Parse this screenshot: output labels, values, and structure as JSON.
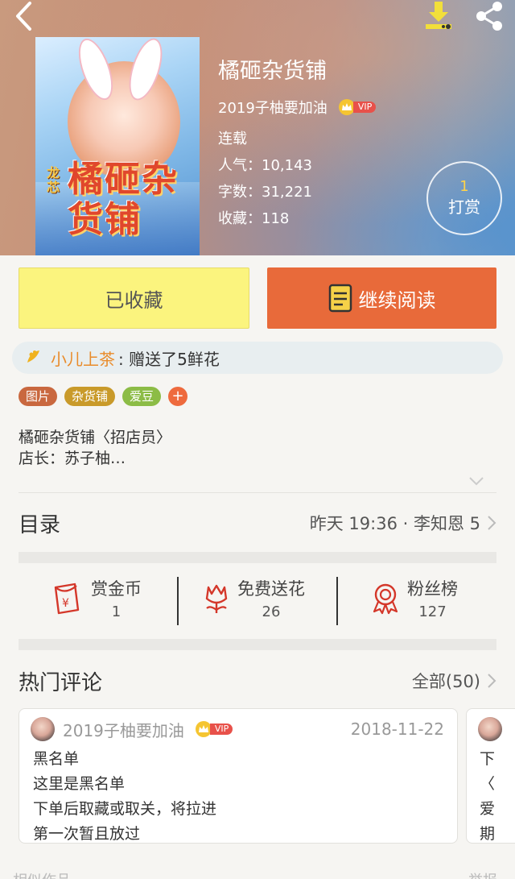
{
  "book": {
    "title": "橘砸杂货铺",
    "author": "2019子柚要加油",
    "vip_label": "VIP",
    "status": "连载",
    "popularity": "人气：10,143",
    "word_count": "字数：31,221",
    "favorites": "收藏：118",
    "cover_title": "橘砸杂货铺",
    "cover_tag": "龙芯"
  },
  "reward": {
    "count": "1",
    "label": "打赏"
  },
  "actions": {
    "collect_label": "已收藏",
    "read_label": "继续阅读"
  },
  "gift": {
    "giver": "小儿上茶",
    "message": ": 赠送了5鲜花"
  },
  "tags": [
    "图片",
    "杂货铺",
    "爱豆"
  ],
  "tag_add": "+",
  "description": {
    "line1": "橘砸杂货铺〈招店员〉",
    "line2": "店长：苏子柚…"
  },
  "catalog": {
    "title": "目录",
    "latest": "昨天 19:36 · 李知恩 5"
  },
  "stats": [
    {
      "name": "赏金币",
      "value": "1"
    },
    {
      "name": "免费送花",
      "value": "26"
    },
    {
      "name": "粉丝榜",
      "value": "127"
    }
  ],
  "hot_comments": {
    "title": "热门评论",
    "all_label": "全部(50)"
  },
  "comments": [
    {
      "user": "2019子柚要加油",
      "vip_label": "VIP",
      "date": "2018-11-22",
      "lines": [
        "黑名单",
        "这里是黑名单",
        "下单后取藏或取关，将拉进",
        "第一次暂且放过"
      ]
    },
    {
      "lines": [
        "下",
        "〈",
        "爱",
        "期"
      ]
    }
  ],
  "footer": {
    "left": "相似作品",
    "right": "举报"
  },
  "colors": {
    "accent_orange": "#e86a3a",
    "collect_yellow": "#fbf47e",
    "tag_red": "#c9683f",
    "tag_gold": "#c99a2a",
    "tag_green": "#8cbc46"
  }
}
